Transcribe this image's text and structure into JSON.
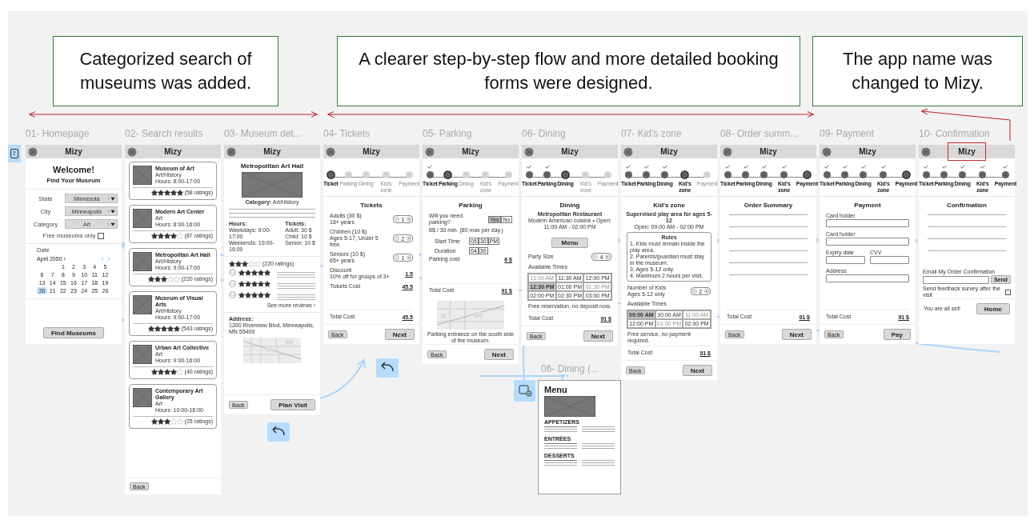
{
  "annotations": [
    {
      "text": "Categorized search of museums was added."
    },
    {
      "text": "A clearer step-by-step flow and more detailed booking forms were designed."
    },
    {
      "text": "The app name was changed to Mizy."
    }
  ],
  "frames": [
    {
      "title": "01- Homepage",
      "app_name": "Mizy",
      "highlighted": false,
      "kind": "home",
      "welcome": "Welcome!",
      "subtitle": "Find Your Museum",
      "filters": [
        {
          "label": "State",
          "value": "Minnesota"
        },
        {
          "label": "City",
          "value": "Minneapolis"
        },
        {
          "label": "Category",
          "value": "Art"
        }
      ],
      "free_only": {
        "label": "Free museums only",
        "checked": false
      },
      "date_label": "Date",
      "calendar": {
        "month": "April 2050 ›",
        "days": [
          {
            "day": "1",
            "selected": false
          },
          {
            "day": "2",
            "selected": false
          },
          {
            "day": "3",
            "selected": false
          },
          {
            "day": "4",
            "selected": false
          },
          {
            "day": "5",
            "selected": false
          },
          {
            "day": "6",
            "selected": false
          },
          {
            "day": "7",
            "selected": false
          },
          {
            "day": "8",
            "selected": false
          },
          {
            "day": "9",
            "selected": false
          },
          {
            "day": "10",
            "selected": false
          },
          {
            "day": "11",
            "selected": false
          },
          {
            "day": "12",
            "selected": false
          },
          {
            "day": "13",
            "selected": false
          },
          {
            "day": "14",
            "selected": false
          },
          {
            "day": "15",
            "selected": false
          },
          {
            "day": "16",
            "selected": false
          },
          {
            "day": "17",
            "selected": false
          },
          {
            "day": "18",
            "selected": false
          },
          {
            "day": "19",
            "selected": false
          },
          {
            "day": "20",
            "selected": true
          },
          {
            "day": "21",
            "selected": false
          },
          {
            "day": "22",
            "selected": false
          },
          {
            "day": "23",
            "selected": false
          },
          {
            "day": "24",
            "selected": false
          },
          {
            "day": "25",
            "selected": false
          },
          {
            "day": "26",
            "selected": false
          }
        ]
      },
      "button": "Find Museums"
    },
    {
      "title": "02- Search results",
      "app_name": "Mizy",
      "highlighted": false,
      "kind": "results",
      "cards": [
        {
          "name": "Museum of Art",
          "category": "Art/History",
          "hours": "Hours: 8:00-17:00",
          "stars": 5,
          "ratings": "(58 ratings)"
        },
        {
          "name": "Modern Art Center",
          "category": "Art",
          "hours": "Hours: 8:00-16:00",
          "stars": 4,
          "ratings": "(87 ratings)"
        },
        {
          "name": "Metropolitan Art Hall",
          "category": "Art/History",
          "hours": "Hours: 9:00-17:00",
          "stars": 3,
          "ratings": "(220 ratings)"
        },
        {
          "name": "Museum of Visual Arts",
          "category": "Art/History",
          "hours": "Hours: 9:00-17:00",
          "stars": 5,
          "ratings": "(543 ratings)"
        },
        {
          "name": "Urban Art Collective",
          "category": "Art",
          "hours": "Hours: 9:00-16:00",
          "stars": 4,
          "ratings": "(40 ratings)"
        },
        {
          "name": "Contemporary Art Gallery",
          "category": "Art",
          "hours": "Hours: 10:00-18:00",
          "stars": 3,
          "ratings": "(25 ratings)"
        }
      ],
      "buttons": [
        "Back"
      ]
    },
    {
      "title": "03- Museum det...",
      "app_name": "Mizy",
      "highlighted": false,
      "kind": "details",
      "museum": "Metropolitan Art Hall",
      "category": "**Category:** Art/History",
      "hours": {
        "title": "Hours:",
        "lines": [
          "Weekdays: 9:00-17:00",
          "Weekends: 10:00-16:00"
        ]
      },
      "tickets": {
        "title": "Tickets:",
        "lines": [
          "Adult: 30 $",
          "Child: 10 $",
          "Senior: 10 $"
        ]
      },
      "stars": 3,
      "ratings": "(220 ratings)",
      "reviews": [
        {
          "stars": 5
        },
        {
          "stars": 5
        },
        {
          "stars": 5
        }
      ],
      "more": "See more reviews ›",
      "address_label": "Address:",
      "address": "1200 Riverview Blvd, Minneapolis, MN 55400",
      "buttons": [
        "Back",
        "Plan Visit"
      ]
    },
    {
      "title": "04- Tickets",
      "app_name": "Mizy",
      "highlighted": false,
      "kind": "tickets",
      "steps": [
        {
          "label": "Ticket",
          "done": false,
          "selected": true
        },
        {
          "label": "Parking",
          "done": false,
          "selected": false
        },
        {
          "label": "Dining",
          "done": false,
          "selected": false
        },
        {
          "label": "Kid's zone",
          "done": false,
          "selected": false
        },
        {
          "label": "Payment",
          "done": false,
          "selected": false
        }
      ],
      "heading": "Tickets",
      "items": [
        {
          "name": "Adults (30 $)",
          "note": "18+ years",
          "qty": "1"
        },
        {
          "name": "Children (10 $)",
          "note": "Ages 5-17, Under 5 free.",
          "qty": "2"
        },
        {
          "name": "Seniors (10 $)",
          "note": "65+ years",
          "qty": "1"
        }
      ],
      "costs": [
        {
          "label": "Discount",
          "note": "10% off for groups of 3+",
          "value": "1.5"
        },
        {
          "label": "Tickets Cost",
          "value": "45.5"
        }
      ],
      "total": {
        "label": "Total Cost",
        "value": "45.5"
      },
      "buttons": [
        "Back",
        "Next"
      ]
    },
    {
      "title": "05- Parking",
      "app_name": "Mizy",
      "highlighted": false,
      "kind": "parking",
      "steps": [
        {
          "label": "Ticket",
          "done": true,
          "selected": false
        },
        {
          "label": "Parking",
          "done": false,
          "selected": true
        },
        {
          "label": "Dining",
          "done": false,
          "selected": false
        },
        {
          "label": "Kid's zone",
          "done": false,
          "selected": false
        },
        {
          "label": "Payment",
          "done": false,
          "selected": false
        }
      ],
      "heading": "Parking",
      "question": "Will you need parking?",
      "options": [
        {
          "label": "Yes",
          "selected": true
        },
        {
          "label": "No",
          "selected": false
        }
      ],
      "rate": "8$ / 30 min. (80 max per day.)",
      "time_rows": [
        {
          "label": "Start Time",
          "parts": [
            "05",
            "30",
            "PM"
          ]
        },
        {
          "label": "Duration",
          "parts": [
            "04",
            "30"
          ]
        }
      ],
      "costs": [
        {
          "label": "Parking cost",
          "value": "6 $"
        }
      ],
      "total": {
        "label": "Total Cost",
        "value": "91 $"
      },
      "caption": "Parking entrance on the south side of the museum.",
      "buttons": [
        "Back",
        "Next"
      ]
    },
    {
      "title": "06- Dining",
      "app_name": "Mizy",
      "highlighted": false,
      "kind": "dining",
      "steps": [
        {
          "label": "Ticket",
          "done": true,
          "selected": false
        },
        {
          "label": "Parking",
          "done": true,
          "selected": false
        },
        {
          "label": "Dining",
          "done": false,
          "selected": true
        },
        {
          "label": "Kid's zone",
          "done": false,
          "selected": false
        },
        {
          "label": "Payment",
          "done": false,
          "selected": false
        }
      ],
      "heading": "Dining",
      "restaurant": "Metropolitan Restaurant",
      "info": "Modern American cuisine • Open: 11:00 AM - 02:00 PM",
      "menu_button": "Menu",
      "party": {
        "label": "Party Size",
        "qty": "4"
      },
      "times_label": "Available Times",
      "times": [
        {
          "time": "11:00 AM",
          "selected": false,
          "disabled": true
        },
        {
          "time": "11:30 AM",
          "selected": false,
          "disabled": false
        },
        {
          "time": "12:00 PM",
          "selected": false,
          "disabled": false
        },
        {
          "time": "12:30 PM",
          "selected": true,
          "disabled": false
        },
        {
          "time": "01:00 PM",
          "selected": false,
          "disabled": false
        },
        {
          "time": "01:30 PM",
          "selected": false,
          "disabled": true
        },
        {
          "time": "02:00 PM",
          "selected": false,
          "disabled": false
        },
        {
          "time": "02:30 PM",
          "selected": false,
          "disabled": false
        },
        {
          "time": "03:00 PM",
          "selected": false,
          "disabled": false
        }
      ],
      "note": "Free reservation, no deposit now.",
      "total": {
        "label": "Total Cost",
        "value": "91 $"
      },
      "buttons": [
        "Back",
        "Next"
      ]
    },
    {
      "title": "07- Kid's zone",
      "app_name": "Mizy",
      "highlighted": false,
      "kind": "kids",
      "steps": [
        {
          "label": "Ticket",
          "done": true,
          "selected": false
        },
        {
          "label": "Parking",
          "done": true,
          "selected": false
        },
        {
          "label": "Dining",
          "done": true,
          "selected": false
        },
        {
          "label": "Kid's zone",
          "done": false,
          "selected": true
        },
        {
          "label": "Payment",
          "done": false,
          "selected": false
        }
      ],
      "heading": "Kid's zone",
      "subtitle": "Supervised play area for ages 5-12",
      "hours": "Open: 09:00 AM - 02:00 PM",
      "rules": {
        "title": "Rules",
        "items": [
          "1. Kids must remain inside the play area.",
          "2. Parents/guardian must stay in the museum.",
          "3. Ages 5-12 only.",
          "4. Maximum 2 hours per visit."
        ]
      },
      "count": {
        "label": "Number of Kids",
        "note": "Ages 5-12 only",
        "qty": "2"
      },
      "times_label": "Available Times",
      "times": [
        {
          "time": "09:00 AM",
          "selected": true,
          "disabled": false
        },
        {
          "time": "10:00 AM",
          "selected": false,
          "disabled": false
        },
        {
          "time": "11:00 AM",
          "selected": false,
          "disabled": true
        },
        {
          "time": "12:00 PM",
          "selected": false,
          "disabled": false
        },
        {
          "time": "01:00 PM",
          "selected": false,
          "disabled": true
        },
        {
          "time": "02:00 PM",
          "selected": false,
          "disabled": false
        }
      ],
      "note": "Free service, no payment required.",
      "total": {
        "label": "Total Cost",
        "value": "91 $"
      },
      "buttons": [
        "Back",
        "Next"
      ]
    },
    {
      "title": "08- Order summ...",
      "app_name": "Mizy",
      "highlighted": false,
      "kind": "summary",
      "steps": [
        {
          "label": "Ticket",
          "done": true,
          "selected": false
        },
        {
          "label": "Parking",
          "done": true,
          "selected": false
        },
        {
          "label": "Dining",
          "done": true,
          "selected": false
        },
        {
          "label": "Kid's zone",
          "done": true,
          "selected": false
        },
        {
          "label": "Payment",
          "done": false,
          "selected": true
        }
      ],
      "heading": "Order Summary",
      "total": {
        "label": "Total Cost",
        "value": "91 $"
      },
      "buttons": [
        "Back",
        "Next"
      ]
    },
    {
      "title": "09- Payment",
      "app_name": "Mizy",
      "highlighted": false,
      "kind": "payment",
      "steps": [
        {
          "label": "Ticket",
          "done": true,
          "selected": false
        },
        {
          "label": "Parking",
          "done": true,
          "selected": false
        },
        {
          "label": "Dining",
          "done": true,
          "selected": false
        },
        {
          "label": "Kid's zone",
          "done": true,
          "selected": false
        },
        {
          "label": "Payment",
          "done": false,
          "selected": true
        }
      ],
      "heading": "Payment",
      "field_rows": [
        {
          "fields": [
            {
              "label": "Card holder"
            }
          ]
        },
        {
          "fields": [
            {
              "label": "Card holder"
            }
          ]
        },
        {
          "fields": [
            {
              "label": "Expiry date"
            },
            {
              "label": "CVV"
            }
          ]
        },
        {
          "fields": [
            {
              "label": "Address"
            }
          ]
        }
      ],
      "total": {
        "label": "Total Cost",
        "value": "91 $"
      },
      "buttons": [
        "Back",
        "Pay"
      ]
    },
    {
      "title": "10- Confirmation",
      "app_name": "Mizy",
      "highlighted": true,
      "kind": "confirmation",
      "steps": [
        {
          "label": "Ticket",
          "done": true,
          "selected": false
        },
        {
          "label": "Parking",
          "done": true,
          "selected": false
        },
        {
          "label": "Dining",
          "done": true,
          "selected": false
        },
        {
          "label": "Kid's zone",
          "done": true,
          "selected": false
        },
        {
          "label": "Payment",
          "done": true,
          "selected": false
        }
      ],
      "heading": "Confirmation",
      "email": {
        "label": "Email My Order Confirmation",
        "button": "Send"
      },
      "feedback": {
        "label": "Send feedback survey after the visit",
        "checked": false
      },
      "message": "You are all set!",
      "buttons": [
        "Home"
      ]
    }
  ],
  "menu_frame": {
    "title": "06- Dining (...",
    "heading": "Menu",
    "sections": [
      "APPETIZERS",
      "ENTRÉES",
      "DESSERTS"
    ]
  }
}
